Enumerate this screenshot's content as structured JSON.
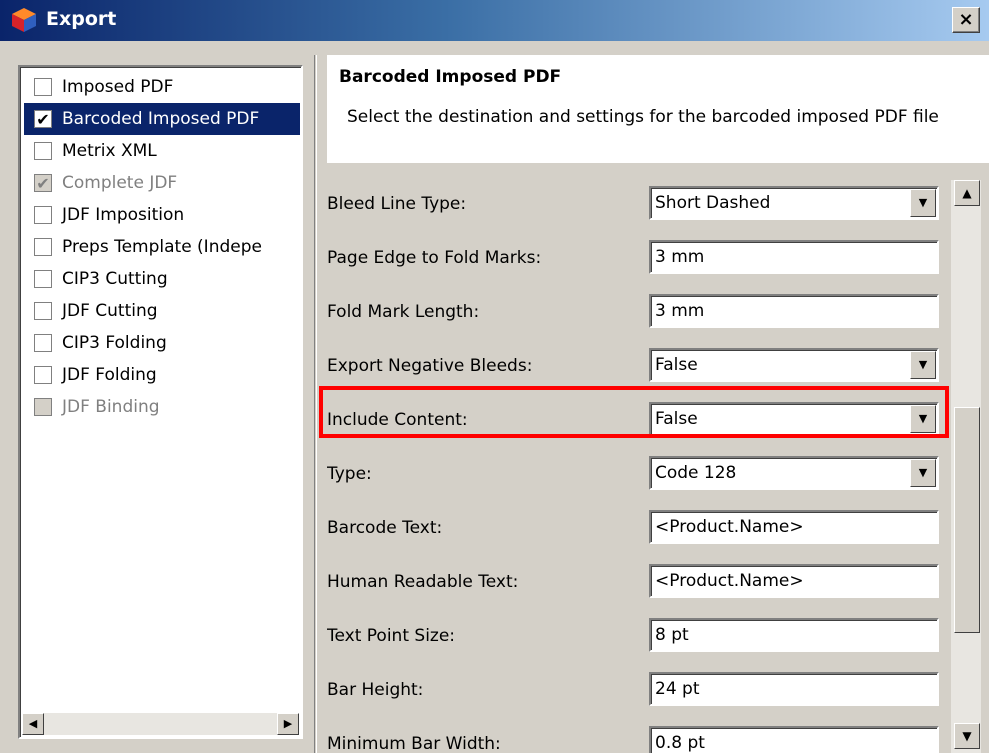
{
  "window": {
    "title": "Export",
    "close_label": "×"
  },
  "export_types": [
    {
      "label": "Imposed PDF",
      "checked": false,
      "disabled": false,
      "selected": false
    },
    {
      "label": "Barcoded Imposed PDF",
      "checked": true,
      "disabled": false,
      "selected": true
    },
    {
      "label": "Metrix XML",
      "checked": false,
      "disabled": false,
      "selected": false
    },
    {
      "label": "Complete JDF",
      "checked": true,
      "disabled": true,
      "selected": false
    },
    {
      "label": "JDF Imposition",
      "checked": false,
      "disabled": false,
      "selected": false
    },
    {
      "label": "Preps Template (Indepe",
      "checked": false,
      "disabled": false,
      "selected": false
    },
    {
      "label": "CIP3 Cutting",
      "checked": false,
      "disabled": false,
      "selected": false
    },
    {
      "label": "JDF Cutting",
      "checked": false,
      "disabled": false,
      "selected": false
    },
    {
      "label": "CIP3 Folding",
      "checked": false,
      "disabled": false,
      "selected": false
    },
    {
      "label": "JDF Folding",
      "checked": false,
      "disabled": false,
      "selected": false
    },
    {
      "label": "JDF Binding",
      "checked": false,
      "disabled": true,
      "selected": false
    }
  ],
  "header": {
    "title": "Barcoded Imposed PDF",
    "description": "Select the destination and settings for the barcoded imposed PDF file"
  },
  "properties": [
    {
      "label": "Bleed Line Type:",
      "value": "Short Dashed",
      "kind": "dropdown"
    },
    {
      "label": "Page Edge to Fold Marks:",
      "value": "3 mm",
      "kind": "text"
    },
    {
      "label": "Fold Mark Length:",
      "value": "3 mm",
      "kind": "text"
    },
    {
      "label": "Export Negative Bleeds:",
      "value": "False",
      "kind": "dropdown"
    },
    {
      "label": "Include Content:",
      "value": "False",
      "kind": "dropdown"
    },
    {
      "label": "Type:",
      "value": "Code 128",
      "kind": "dropdown"
    },
    {
      "label": "Barcode Text:",
      "value": "<Product.Name>",
      "kind": "text"
    },
    {
      "label": "Human Readable Text:",
      "value": "<Product.Name>",
      "kind": "text"
    },
    {
      "label": "Text Point Size:",
      "value": "8 pt",
      "kind": "text"
    },
    {
      "label": "Bar Height:",
      "value": "24 pt",
      "kind": "text"
    },
    {
      "label": "Minimum Bar Width:",
      "value": "0.8 pt",
      "kind": "text"
    }
  ],
  "icons": {
    "app": "cube-icon",
    "check": "✔",
    "dropdown_arrow": "▼",
    "scroll_up": "▲",
    "scroll_down": "▼",
    "scroll_left": "◀",
    "scroll_right": "▶"
  },
  "colors": {
    "selection": "#0a246a",
    "highlight": "#ff0000"
  }
}
